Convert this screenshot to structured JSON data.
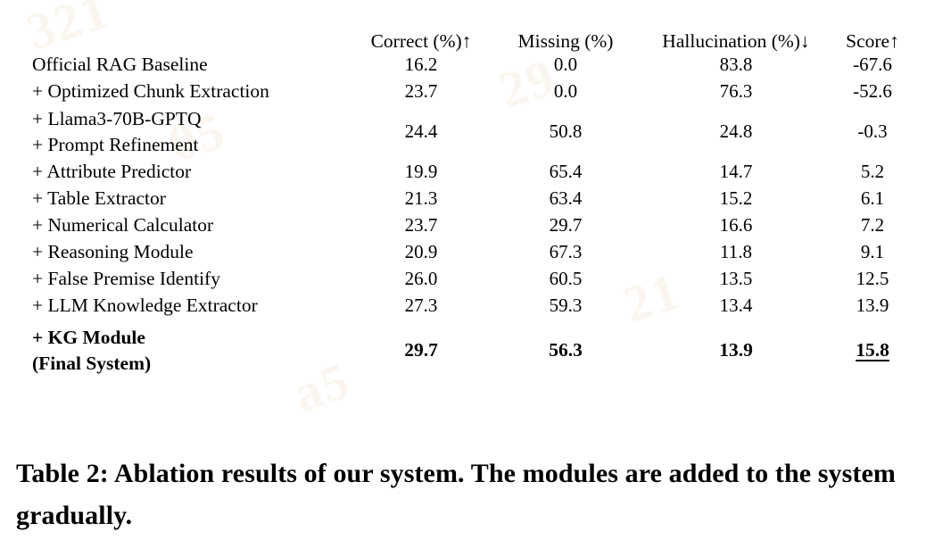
{
  "table": {
    "columns": [
      {
        "key": "method",
        "label": ""
      },
      {
        "key": "correct",
        "label": "Correct (%)↑"
      },
      {
        "key": "missing",
        "label": "Missing (%)"
      },
      {
        "key": "hallucination",
        "label": "Hallucination (%)↓"
      },
      {
        "key": "score",
        "label": "Score↑"
      }
    ],
    "rows": [
      {
        "method": "Official RAG Baseline",
        "method_line2": "",
        "correct": "16.2",
        "missing": "0.0",
        "hallucination": "83.8",
        "score": "-67.6"
      },
      {
        "method": "+ Optimized Chunk Extraction",
        "method_line2": "",
        "correct": "23.7",
        "missing": "0.0",
        "hallucination": "76.3",
        "score": "-52.6"
      },
      {
        "method": "+ Llama3-70B-GPTQ",
        "method_line2": "+ Prompt Refinement",
        "correct": "24.4",
        "missing": "50.8",
        "hallucination": "24.8",
        "score": "-0.3"
      },
      {
        "method": "+ Attribute Predictor",
        "method_line2": "",
        "correct": "19.9",
        "missing": "65.4",
        "hallucination": "14.7",
        "score": "5.2"
      },
      {
        "method": "+ Table Extractor",
        "method_line2": "",
        "correct": "21.3",
        "missing": "63.4",
        "hallucination": "15.2",
        "score": "6.1"
      },
      {
        "method": "+ Numerical Calculator",
        "method_line2": "",
        "correct": "23.7",
        "missing": "29.7",
        "hallucination": "16.6",
        "score": "7.2"
      },
      {
        "method": "+ Reasoning Module",
        "method_line2": "",
        "correct": "20.9",
        "missing": "67.3",
        "hallucination": "11.8",
        "score": "9.1"
      },
      {
        "method": "+ False Premise Identify",
        "method_line2": "",
        "correct": "26.0",
        "missing": "60.5",
        "hallucination": "13.5",
        "score": "12.5"
      },
      {
        "method": "+ LLM Knowledge Extractor",
        "method_line2": "",
        "correct": "27.3",
        "missing": "59.3",
        "hallucination": "13.4",
        "score": "13.9"
      }
    ],
    "final_row": {
      "method": "+ KG Module",
      "method_line2": "(Final System)",
      "correct": "29.7",
      "missing": "56.3",
      "hallucination": "13.9",
      "score": "15.8"
    }
  },
  "caption": {
    "text": "Table 2: Ablation results of our system. The modules are added to the system gradually."
  },
  "colors": {
    "text": "#000000",
    "rule": "#1a1a1a",
    "background": "#ffffff"
  }
}
